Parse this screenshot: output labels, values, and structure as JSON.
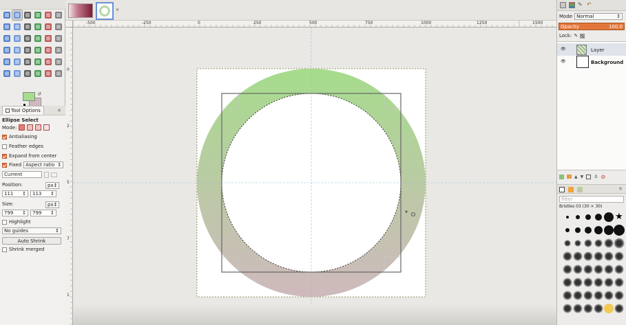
{
  "toolbox": {
    "tools": [
      "rect-select-icon",
      "ellipse-select-icon",
      "free-select-icon",
      "fuzzy-select-icon",
      "color-select-icon",
      "scissors-icon",
      "foreground-select-icon",
      "paths-icon",
      "color-picker-icon",
      "zoom-icon",
      "measure-icon",
      "move-icon",
      "align-icon",
      "crop-icon",
      "rotate-icon",
      "scale-icon",
      "shear-icon",
      "perspective-icon",
      "flip-icon",
      "cage-icon",
      "unified-transform-icon",
      "warp-icon",
      "text-icon",
      "bucket-fill-icon",
      "blend-icon",
      "pencil-icon",
      "paintbrush-icon",
      "eraser-icon",
      "airbrush-icon",
      "ink-icon",
      "clone-icon",
      "heal-icon",
      "smudge-icon",
      "dodge-icon",
      "blur-icon",
      "mypaint-icon"
    ],
    "fg_color": "#a6dc8c",
    "bg_color": "#cfb9bd"
  },
  "tool_options": {
    "tab_label": "Tool Options",
    "tool_name": "Ellipse Select",
    "mode_label": "Mode:",
    "antialiasing": {
      "label": "Antialiasing",
      "checked": true
    },
    "feather_edges": {
      "label": "Feather edges",
      "checked": false
    },
    "expand_from_center": {
      "label": "Expand from center",
      "checked": true
    },
    "fixed": {
      "label": "Fixed",
      "checked": true,
      "value": "Aspect ratio"
    },
    "current_value": "Current",
    "position_label": "Position:",
    "position_unit": "px",
    "position_x": "111",
    "position_y": "113",
    "size_label": "Size:",
    "size_unit": "px",
    "size_w": "799",
    "size_h": "799",
    "highlight": {
      "label": "Highlight",
      "checked": false
    },
    "guides_value": "No guides",
    "auto_shrink_label": "Auto Shrink",
    "shrink_merged": {
      "label": "Shrink merged",
      "checked": false
    }
  },
  "ruler_h": [
    "-500",
    "-250",
    "0",
    "250",
    "500",
    "750",
    "1000",
    "1250",
    "1500"
  ],
  "ruler_v": [
    "0",
    "2",
    "5",
    "7",
    "1"
  ],
  "dock": {
    "mode_label": "Mode",
    "mode_value": "Normal",
    "opacity_label": "Opacity",
    "opacity_value": "100.0",
    "lock_label": "Lock:",
    "layers": [
      {
        "name": "Layer"
      },
      {
        "name": "Background"
      }
    ],
    "brush_filter_placeholder": "filter",
    "brush_name": "Bristles 03 (30 × 30)"
  },
  "colors": {
    "accent": "#e2763a",
    "ring_top": "#a6dc8c",
    "ring_bottom": "#cfb9bd"
  }
}
